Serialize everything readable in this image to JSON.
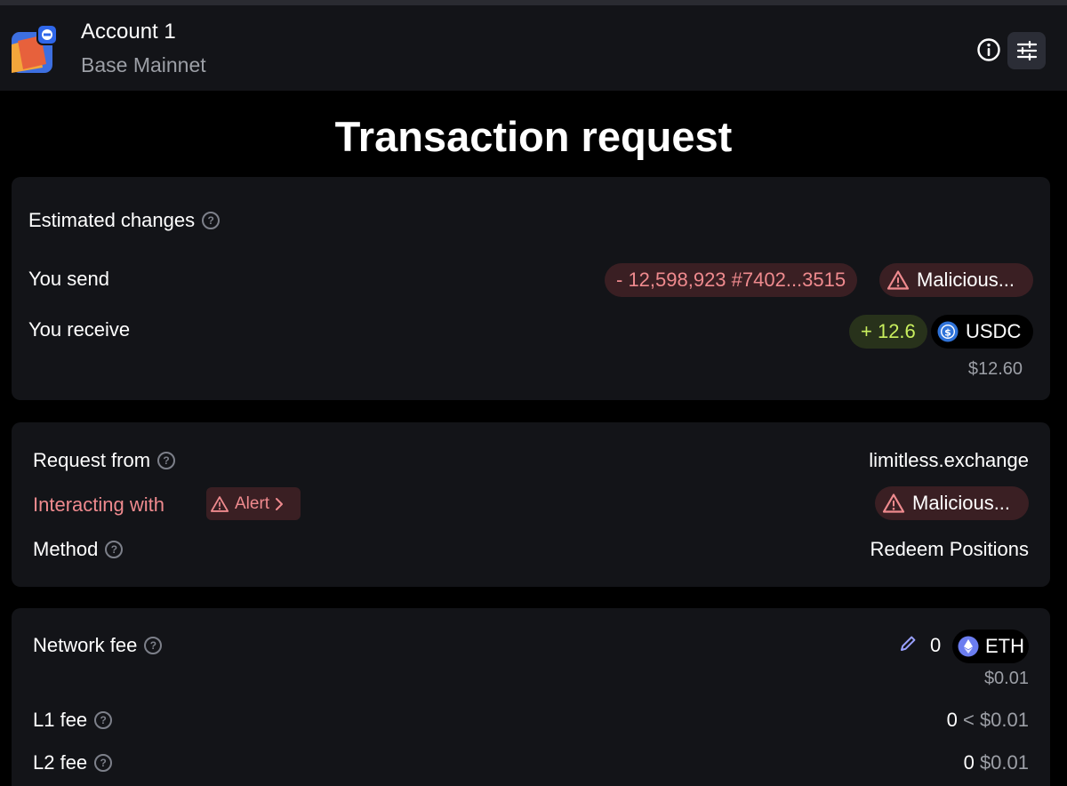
{
  "header": {
    "account_name": "Account 1",
    "network": "Base Mainnet",
    "info_icon": "info-circle-icon",
    "settings_icon": "sliders-icon"
  },
  "title": "Transaction request",
  "estimated_changes": {
    "heading": "Estimated changes",
    "send": {
      "label": "You send",
      "amount": "- 12,598,923 #7402...3515",
      "token_status": "Malicious..."
    },
    "receive": {
      "label": "You receive",
      "amount": "+ 12.6",
      "token": "USDC",
      "usd": "$12.60"
    }
  },
  "request": {
    "from_label": "Request from",
    "from_value": "limitless.exchange",
    "interacting_label": "Interacting with",
    "alert_label": "Alert",
    "interacting_value": "Malicious...",
    "method_label": "Method",
    "method_value": "Redeem Positions"
  },
  "fees": {
    "network_label": "Network fee",
    "network_amount": "0",
    "network_token": "ETH",
    "network_usd": "$0.01",
    "l1_label": "L1 fee",
    "l1_amount": "0",
    "l1_usd": "< $0.01",
    "l2_label": "L2 fee",
    "l2_amount": "0",
    "l2_usd": "$0.01"
  },
  "colors": {
    "background": "#000000",
    "card": "#131418",
    "danger": "#ef8a8e",
    "danger_bg": "#3a1f23",
    "positive": "#c9ef5e",
    "positive_bg": "#28321b",
    "muted": "#9c9fa6"
  }
}
